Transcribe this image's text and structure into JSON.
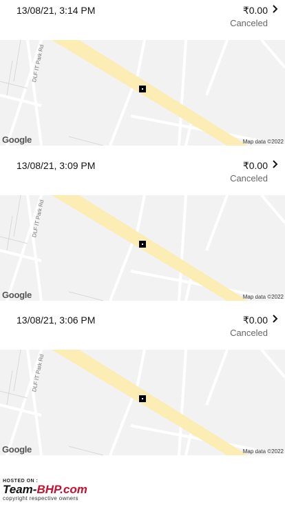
{
  "trips": [
    {
      "datetime": "13/08/21, 3:14 PM",
      "fare": "₹0.00",
      "status": "Canceled"
    },
    {
      "datetime": "13/08/21, 3:09 PM",
      "fare": "₹0.00",
      "status": "Canceled"
    },
    {
      "datetime": "13/08/21, 3:06 PM",
      "fare": "₹0.00",
      "status": "Canceled"
    }
  ],
  "map": {
    "road_label": "DLF IT Park Rd",
    "google_logo": "Google",
    "attribution": "Map data ©2022"
  },
  "watermark": {
    "hosted_on": "HOSTED ON :",
    "logo_part1": "Team-",
    "logo_part2": "BHP",
    "logo_part3": ".com",
    "copyright": "copyright respective owners"
  },
  "colors": {
    "road_highlight": "#fbedb3",
    "map_background": "#f2f2f2",
    "street_lines": "#ffffff",
    "status_text": "#666666"
  },
  "icons": [
    "chevron-right-icon",
    "pickup-marker-icon"
  ]
}
